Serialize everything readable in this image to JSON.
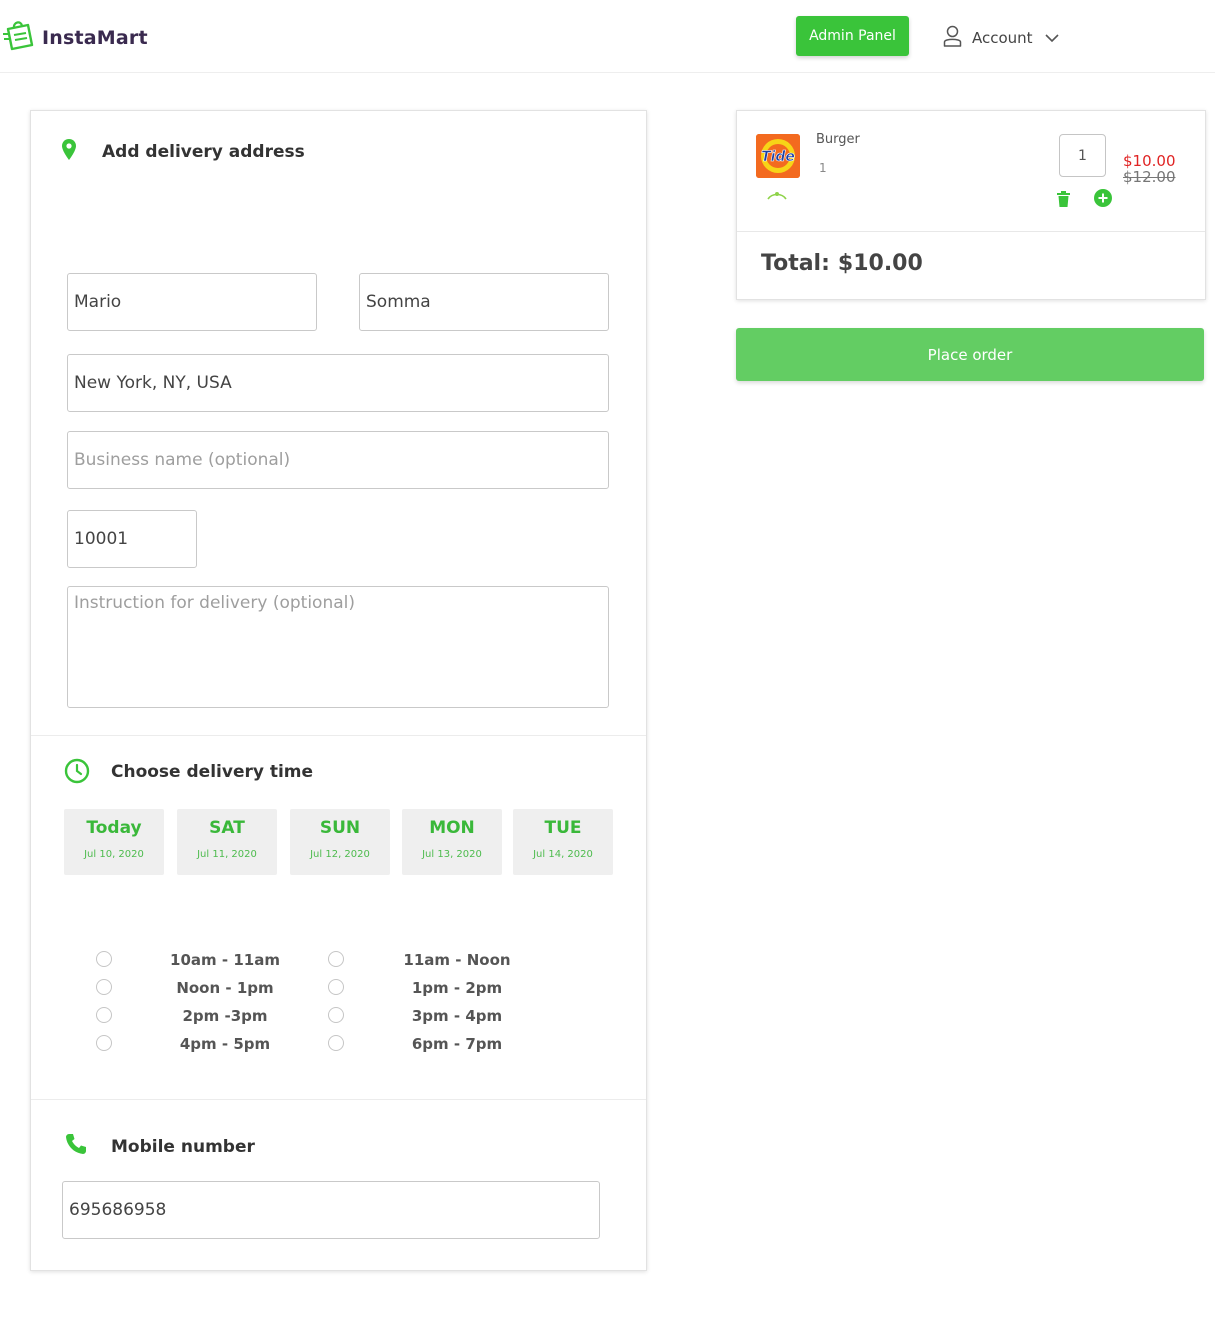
{
  "header": {
    "brand": "InstaMart",
    "admin_label": "Admin Panel",
    "account_label": "Account",
    "accent": "#3ac43a"
  },
  "address": {
    "title": "Add delivery address",
    "first_name": "Mario",
    "last_name": "Somma",
    "location": "New York, NY, USA",
    "business_placeholder": "Business name (optional)",
    "zip": "10001",
    "instructions_placeholder": "Instruction for delivery (optional)"
  },
  "delivery": {
    "title": "Choose delivery time",
    "days": [
      {
        "name": "Today",
        "date": "Jul 10, 2020"
      },
      {
        "name": "SAT",
        "date": "Jul 11, 2020"
      },
      {
        "name": "SUN",
        "date": "Jul 12, 2020"
      },
      {
        "name": "MON",
        "date": "Jul 13, 2020"
      },
      {
        "name": "TUE",
        "date": "Jul 14, 2020"
      }
    ],
    "slots_left": [
      "10am - 11am",
      "Noon - 1pm",
      "2pm -3pm",
      "4pm - 5pm"
    ],
    "slots_right": [
      "11am - Noon",
      "1pm - 2pm",
      "3pm - 4pm",
      "6pm - 7pm"
    ]
  },
  "mobile": {
    "title": "Mobile number",
    "value": "695686958"
  },
  "cart": {
    "item_name": "Burger",
    "item_qty_text": "1",
    "qty_value": "1",
    "price_now": "$10.00",
    "price_old": "$12.00",
    "total_label": "Total:",
    "total_value": "$10.00",
    "place_order": "Place order",
    "thumb_brand": "Tide"
  }
}
